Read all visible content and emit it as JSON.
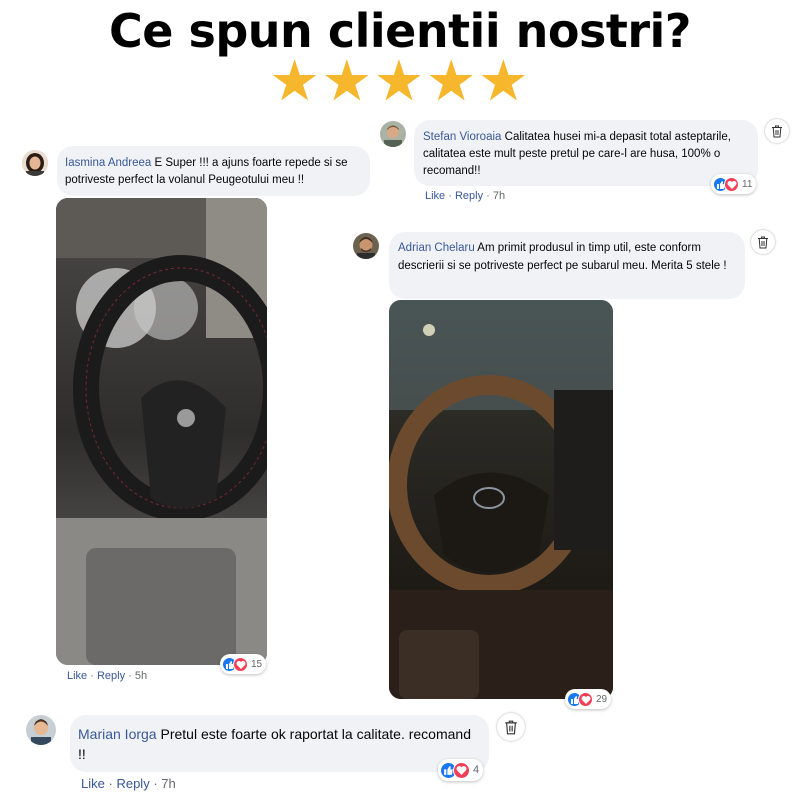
{
  "header": {
    "title": "Ce spun clientii nostri?",
    "stars": "★★★★★"
  },
  "comments": [
    {
      "author": "Iasmina Andreea",
      "text": "E Super !!! a ajuns foarte repede si se potriveste perfect la volanul Peugeotului meu !!",
      "like": "Like",
      "reply": "Reply",
      "time": "5h",
      "reactions": "15",
      "avatar_icon": "avatar-woman",
      "photo_icon": "steering-wheel-photo"
    },
    {
      "author": "Stefan Vioroaia",
      "text": "Calitatea husei mi-a depasit total asteptarile, calitatea este mult peste pretul pe care-l are husa, 100% o recomand!!",
      "like": "Like",
      "reply": "Reply",
      "time": "7h",
      "reactions": "11",
      "avatar_icon": "avatar-man"
    },
    {
      "author": "Adrian Chelaru",
      "text": "Am primit produsul in timp util, este conform descrierii si se potriveste perfect pe subarul meu. Merita 5 stele !",
      "reactions": "29",
      "avatar_icon": "avatar-man",
      "photo_icon": "steering-wheel-photo"
    },
    {
      "author": "Marian Iorga",
      "text": "Pretul este foarte ok raportat la calitate. recomand !!",
      "like": "Like",
      "reply": "Reply",
      "time": "7h",
      "reactions": "4",
      "avatar_icon": "avatar-man"
    }
  ],
  "separator": "·",
  "colors": {
    "name": "#385898",
    "bubble": "#f0f2f5",
    "star": "#f7b72c",
    "like": "#1877f2",
    "love": "#f33e58"
  }
}
